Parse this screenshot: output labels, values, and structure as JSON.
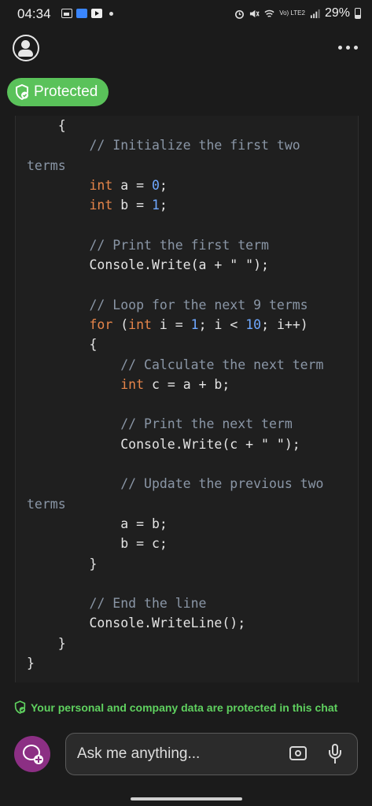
{
  "status_bar": {
    "time": "04:34",
    "battery": "29%",
    "network": "Vo) LTE2"
  },
  "header": {
    "protected_label": "Protected"
  },
  "code_lines": [
    [
      {
        "t": "    {",
        "c": "pl"
      }
    ],
    [
      {
        "t": "        // Initialize the first two",
        "c": "cm"
      }
    ],
    [
      {
        "t": "terms",
        "c": "cm"
      }
    ],
    [
      {
        "t": "        ",
        "c": "pl"
      },
      {
        "t": "int",
        "c": "kw"
      },
      {
        "t": " a = ",
        "c": "pl"
      },
      {
        "t": "0",
        "c": "num"
      },
      {
        "t": ";",
        "c": "pl"
      }
    ],
    [
      {
        "t": "        ",
        "c": "pl"
      },
      {
        "t": "int",
        "c": "kw"
      },
      {
        "t": " b = ",
        "c": "pl"
      },
      {
        "t": "1",
        "c": "num"
      },
      {
        "t": ";",
        "c": "pl"
      }
    ],
    [
      {
        "t": "",
        "c": "pl"
      }
    ],
    [
      {
        "t": "        // Print the first term",
        "c": "cm"
      }
    ],
    [
      {
        "t": "        Console.Write(a + ",
        "c": "pl"
      },
      {
        "t": "\" \"",
        "c": "str"
      },
      {
        "t": ");",
        "c": "pl"
      }
    ],
    [
      {
        "t": "",
        "c": "pl"
      }
    ],
    [
      {
        "t": "        // Loop for the next 9 terms",
        "c": "cm"
      }
    ],
    [
      {
        "t": "        ",
        "c": "pl"
      },
      {
        "t": "for",
        "c": "kw"
      },
      {
        "t": " (",
        "c": "pl"
      },
      {
        "t": "int",
        "c": "kw"
      },
      {
        "t": " i = ",
        "c": "pl"
      },
      {
        "t": "1",
        "c": "num"
      },
      {
        "t": "; i < ",
        "c": "pl"
      },
      {
        "t": "10",
        "c": "num"
      },
      {
        "t": "; i++)",
        "c": "pl"
      }
    ],
    [
      {
        "t": "        {",
        "c": "pl"
      }
    ],
    [
      {
        "t": "            // Calculate the next term",
        "c": "cm"
      }
    ],
    [
      {
        "t": "            ",
        "c": "pl"
      },
      {
        "t": "int",
        "c": "kw"
      },
      {
        "t": " c = a + b;",
        "c": "pl"
      }
    ],
    [
      {
        "t": "",
        "c": "pl"
      }
    ],
    [
      {
        "t": "            // Print the next term",
        "c": "cm"
      }
    ],
    [
      {
        "t": "            Console.Write(c + ",
        "c": "pl"
      },
      {
        "t": "\" \"",
        "c": "str"
      },
      {
        "t": ");",
        "c": "pl"
      }
    ],
    [
      {
        "t": "",
        "c": "pl"
      }
    ],
    [
      {
        "t": "            // Update the previous two",
        "c": "cm"
      }
    ],
    [
      {
        "t": "terms",
        "c": "cm"
      }
    ],
    [
      {
        "t": "            a = b;",
        "c": "pl"
      }
    ],
    [
      {
        "t": "            b = c;",
        "c": "pl"
      }
    ],
    [
      {
        "t": "        }",
        "c": "pl"
      }
    ],
    [
      {
        "t": "",
        "c": "pl"
      }
    ],
    [
      {
        "t": "        // End the line",
        "c": "cm"
      }
    ],
    [
      {
        "t": "        Console.WriteLine();",
        "c": "pl"
      }
    ],
    [
      {
        "t": "    }",
        "c": "pl"
      }
    ],
    [
      {
        "t": "}",
        "c": "pl"
      }
    ]
  ],
  "footer": {
    "privacy_notice": "Your personal and company data are protected in this chat"
  },
  "input": {
    "placeholder": "Ask me anything..."
  },
  "colors": {
    "accent_green": "#5ac25a",
    "new_chat_purple": "#8c2f84",
    "keyword": "#e8864a",
    "number": "#6fa8ff",
    "comment": "#8a96a6"
  }
}
